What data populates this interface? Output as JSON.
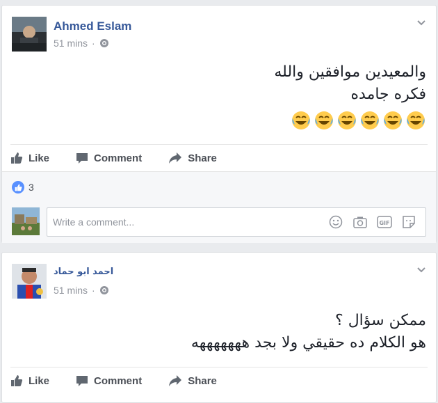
{
  "posts": [
    {
      "author": "Ahmed Eslam",
      "time": "51 mins",
      "separator": "·",
      "text_lines": [
        "والمعيدين موافقين والله",
        "فكره جامده"
      ],
      "emoji_icon": "laughing-tears-emoji",
      "emoji_count": 6,
      "actions": {
        "like": "Like",
        "comment": "Comment",
        "share": "Share"
      },
      "reactions_count": "3",
      "comment_placeholder": "Write a comment..."
    },
    {
      "author": "احمد ابو حماد",
      "time": "51 mins",
      "separator": "·",
      "text_lines": [
        "ممكن سؤال ؟",
        "هو الكلام ده حقيقي ولا بجد هههههههه"
      ],
      "actions": {
        "like": "Like",
        "comment": "Comment",
        "share": "Share"
      }
    }
  ],
  "colors": {
    "author_blue": "#365899",
    "meta_gray": "#90949c",
    "background": "#e9ebee",
    "reaction_blue": "#5890ff"
  }
}
